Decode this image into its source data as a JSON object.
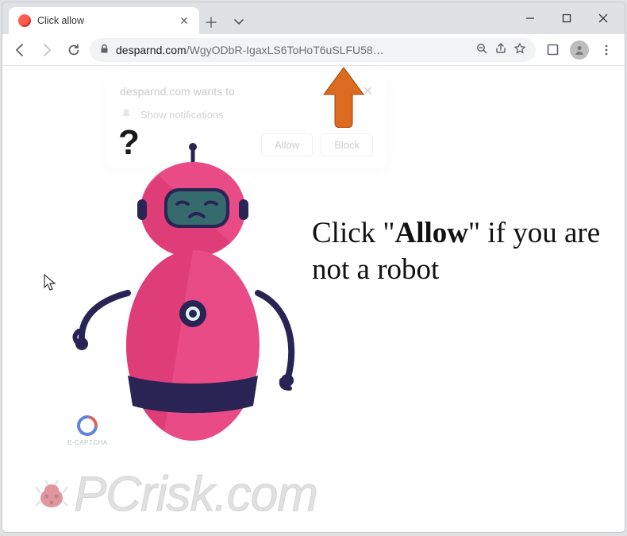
{
  "tab": {
    "title": "Click allow"
  },
  "omnibox": {
    "domain": "desparnd.com",
    "path": "/WgyODbR-IgaxLS6ToHoT6uSLFU58…"
  },
  "perm_popup": {
    "title": "desparnd.com wants to",
    "row": "Show notifications",
    "allow": "Allow",
    "block": "Block"
  },
  "qmark": "?",
  "maintext": {
    "prefix": "Click ",
    "quote_open": "\"",
    "bold": "Allow",
    "quote_close": "\"",
    "suffix": " if you are not a robot"
  },
  "captcha": {
    "label": "E-CAPTCHA"
  },
  "watermark": {
    "text_a": "PC",
    "text_b": "risk.com"
  }
}
